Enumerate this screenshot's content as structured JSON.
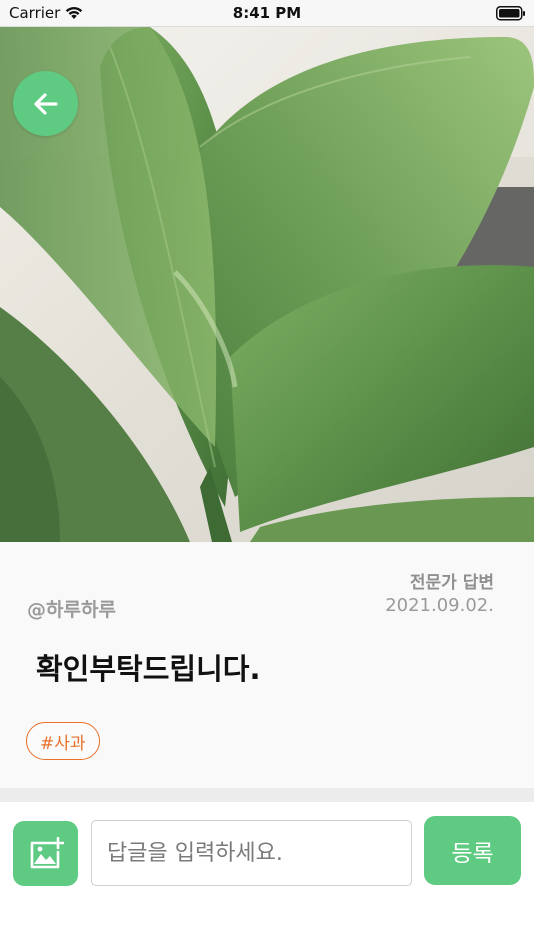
{
  "status_bar": {
    "carrier": "Carrier",
    "time": "8:41 PM"
  },
  "post": {
    "author": "@하루하루",
    "expert_label": "전문가 답변",
    "date": "2021.09.02.",
    "title": "확인부탁드립니다.",
    "tag": "#사과"
  },
  "reply": {
    "placeholder": "답글을 입력하세요.",
    "submit_label": "등록"
  },
  "colors": {
    "accent_green": "#5fca82",
    "tag_orange": "#e8702a"
  },
  "icons": {
    "back": "arrow-left-icon",
    "image_add": "image-add-icon",
    "wifi": "wifi-icon",
    "battery": "battery-icon"
  }
}
